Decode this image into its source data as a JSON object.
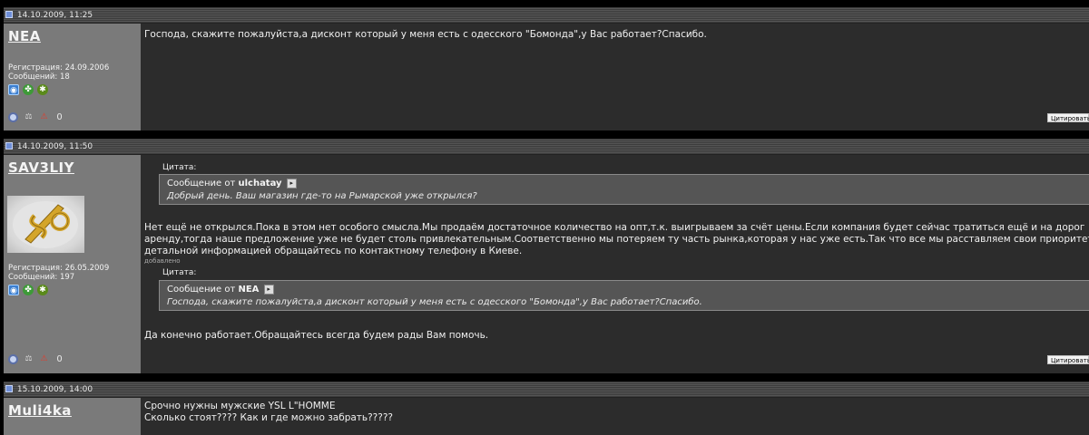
{
  "posts": [
    {
      "date": "14.10.2009, 11:25",
      "username": "NEA",
      "reg": "Регистрация: 24.09.2006",
      "count": "Сообщений: 18",
      "text": "Господа, скажите пожалуйста,а дисконт который у меня есть с одесского \"Бомонда\",у Вас работает?Спасибо.",
      "cite_label": "Цитировать"
    },
    {
      "date": "14.10.2009, 11:50",
      "username": "SAV3LIY",
      "reg": "Регистрация: 26.05.2009",
      "count": "Сообщений: 197",
      "quote1_label": "Цитата:",
      "quote1_prefix": "Сообщение от",
      "quote1_author": "ulchatay",
      "quote1_text": "Добрый день. Ваш магазин где-то на Рымарской уже открылся?",
      "text_line1": "Нет ещё не открылся.Пока в этом нет особого смысла.Мы продаём достаточное количество на опт,т.к. выигрываем за счёт цены.Если компания будет сейчас тратиться ещё и на дорог",
      "text_line2": "аренду,тогда наше предложение уже не будет столь привлекательным.Соответственно мы потеряем ту часть рынка,которая у нас уже есть.Так что все мы расставляем свои приоритет",
      "text_line3": "детальной информацией обращайтесь по контактному телефону в Киеве.",
      "added": "добавлено",
      "quote2_label": "Цитата:",
      "quote2_prefix": "Сообщение от",
      "quote2_author": "NEA",
      "quote2_text": "Господа, скажите пожалуйста,а дисконт который у меня есть с одесского \"Бомонда\",у Вас работает?Спасибо.",
      "text_after": "Да конечно работает.Обращайтесь всегда будем рады Вам помочь.",
      "cite_label": "Цитировать"
    },
    {
      "date": "15.10.2009, 14:00",
      "username": "Muli4ka",
      "text_line1": "Срочно нужны мужские YSL L\"HOMME",
      "text_line2": "Сколько стоят???? Как и где можно забрать?????"
    }
  ],
  "icons": {
    "post": "post-doc-icon",
    "camera": "camera-icon",
    "leaf": "clover-icon",
    "bug": "bug-icon",
    "online": "online-status-icon",
    "scale": "reputation-scale-icon",
    "warn": "warning-icon",
    "zero": "0",
    "quote_link": "view-post-icon"
  }
}
